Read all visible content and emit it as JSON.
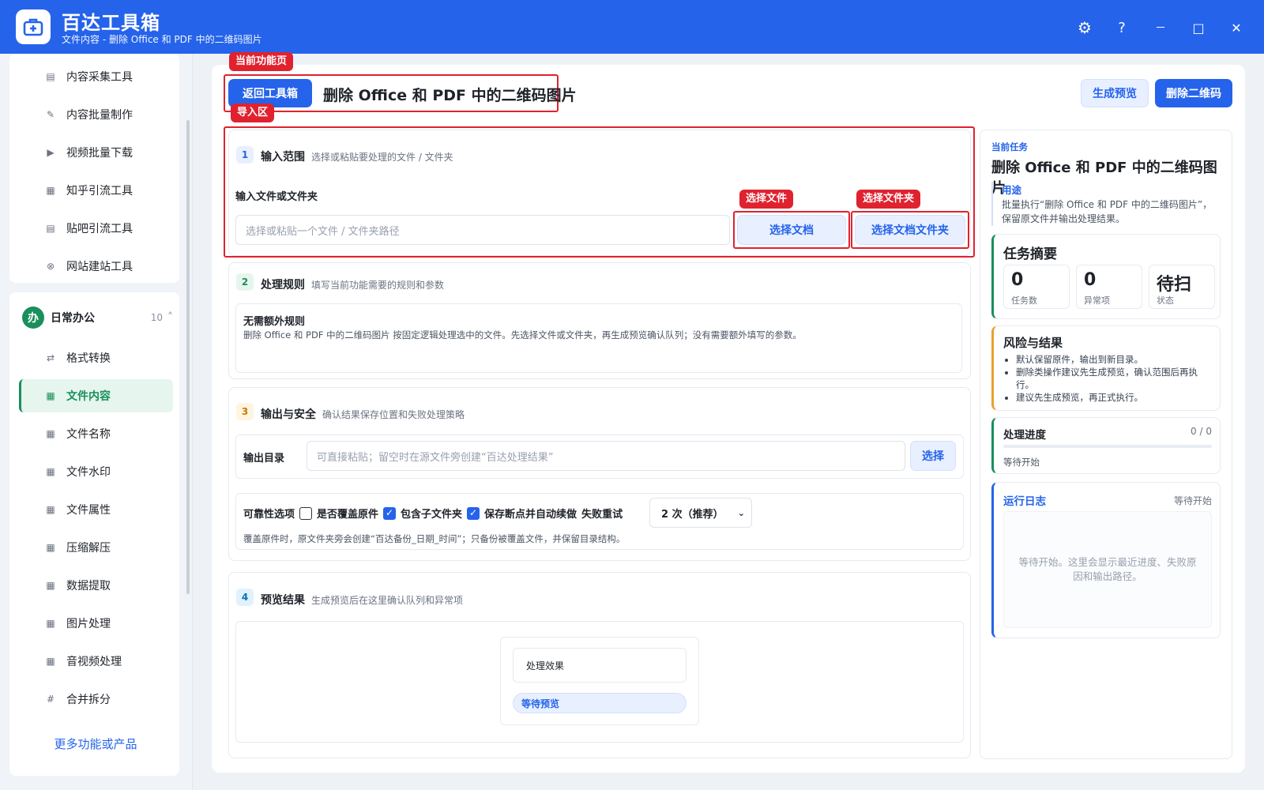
{
  "window": {
    "title": "百达工具箱",
    "subtitle": "文件内容 - 删除 Office 和 PDF 中的二维码图片",
    "controls": {
      "settings": "⚙",
      "help": "?",
      "minimize": "－",
      "maximize": "□",
      "close": "✕"
    }
  },
  "sidebar": {
    "top_items": [
      {
        "label": "内容采集工具",
        "icon": "▤"
      },
      {
        "label": "内容批量制作",
        "icon": "✎"
      },
      {
        "label": "视频批量下载",
        "icon": "▶"
      },
      {
        "label": "知乎引流工具",
        "icon": "▦"
      },
      {
        "label": "贴吧引流工具",
        "icon": "▤"
      },
      {
        "label": "网站建站工具",
        "icon": "⊗"
      }
    ],
    "group": {
      "badge": "办",
      "title": "日常办公",
      "count": "10",
      "chevron": "˄"
    },
    "group_items": [
      {
        "label": "格式转换",
        "icon": "⇄"
      },
      {
        "label": "文件内容",
        "icon": "▦",
        "active": true
      },
      {
        "label": "文件名称",
        "icon": "▦"
      },
      {
        "label": "文件水印",
        "icon": "▦"
      },
      {
        "label": "文件属性",
        "icon": "▦"
      },
      {
        "label": "压缩解压",
        "icon": "▦"
      },
      {
        "label": "数据提取",
        "icon": "▦"
      },
      {
        "label": "图片处理",
        "icon": "▦"
      },
      {
        "label": "音视频处理",
        "icon": "▦"
      },
      {
        "label": "合并拆分",
        "icon": "#"
      }
    ],
    "more_label": "更多功能或产品"
  },
  "annotations": {
    "current_page": "当前功能页",
    "import_zone": "导入区",
    "select_file": "选择文件",
    "select_folder": "选择文件夹"
  },
  "header": {
    "back_label": "返回工具箱",
    "page_title": "删除 Office 和 PDF 中的二维码图片",
    "preview_label": "生成预览",
    "run_label": "删除二维码"
  },
  "sections": {
    "input": {
      "num": "1",
      "title": "输入范围",
      "desc": "选择或粘贴要处理的文件 / 文件夹",
      "field_label": "输入文件或文件夹",
      "placeholder": "选择或粘贴一个文件 / 文件夹路径",
      "choose_file": "选择文档",
      "choose_folder": "选择文档文件夹"
    },
    "rules": {
      "num": "2",
      "title": "处理规则",
      "desc": "填写当前功能需要的规则和参数",
      "box_title": "无需额外规则",
      "box_desc": "删除 Office 和 PDF 中的二维码图片 按固定逻辑处理选中的文件。先选择文件或文件夹，再生成预览确认队列；没有需要额外填写的参数。"
    },
    "output": {
      "num": "3",
      "title": "输出与安全",
      "desc": "确认结果保存位置和失败处理策略",
      "dir_label": "输出目录",
      "dir_placeholder": "可直接粘贴；留空时在源文件旁创建“百达处理结果”",
      "choose": "选择",
      "reliability_label": "可靠性选项",
      "overwrite_label": "是否覆盖原件",
      "overwrite_checked": false,
      "subfolder_label": "包含子文件夹",
      "subfolder_checked": true,
      "resume_label": "保存断点并自动续做",
      "resume_checked": true,
      "retry_label": "失败重试",
      "retry_value": "2 次（推荐）",
      "note": "覆盖原件时，原文件夹旁会创建“百达备份_日期_时间”；只备份被覆盖文件，并保留目录结构。"
    },
    "preview": {
      "num": "4",
      "title": "预览结果",
      "desc": "生成预览后在这里确认队列和异常项",
      "effect_label": "处理效果",
      "status": "等待预览"
    }
  },
  "right": {
    "task_caption": "当前任务",
    "task_title": "删除 Office 和 PDF 中的二维码图片",
    "usage_title": "用途",
    "usage_desc": "批量执行“删除 Office 和 PDF 中的二维码图片”，保留原文件并输出处理结果。",
    "summary_title": "任务摘要",
    "stats": [
      {
        "value": "0",
        "label": "任务数"
      },
      {
        "value": "0",
        "label": "异常项"
      },
      {
        "value": "待扫",
        "label": "状态"
      }
    ],
    "risk_title": "风险与结果",
    "risks": [
      "默认保留原件，输出到新目录。",
      "删除类操作建议先生成预览，确认范围后再执行。",
      "建议先生成预览，再正式执行。"
    ],
    "progress_title": "处理进度",
    "progress_count": "0 / 0",
    "progress_value": 0,
    "progress_status": "等待开始",
    "log_title": "运行日志",
    "log_status": "等待开始",
    "log_placeholder": "等待开始。这里会显示最近进度、失败原因和输出路径。"
  },
  "colors": {
    "primary": "#2563eb",
    "active_green": "#1a8f5c",
    "annotation_red": "#e0222f"
  }
}
